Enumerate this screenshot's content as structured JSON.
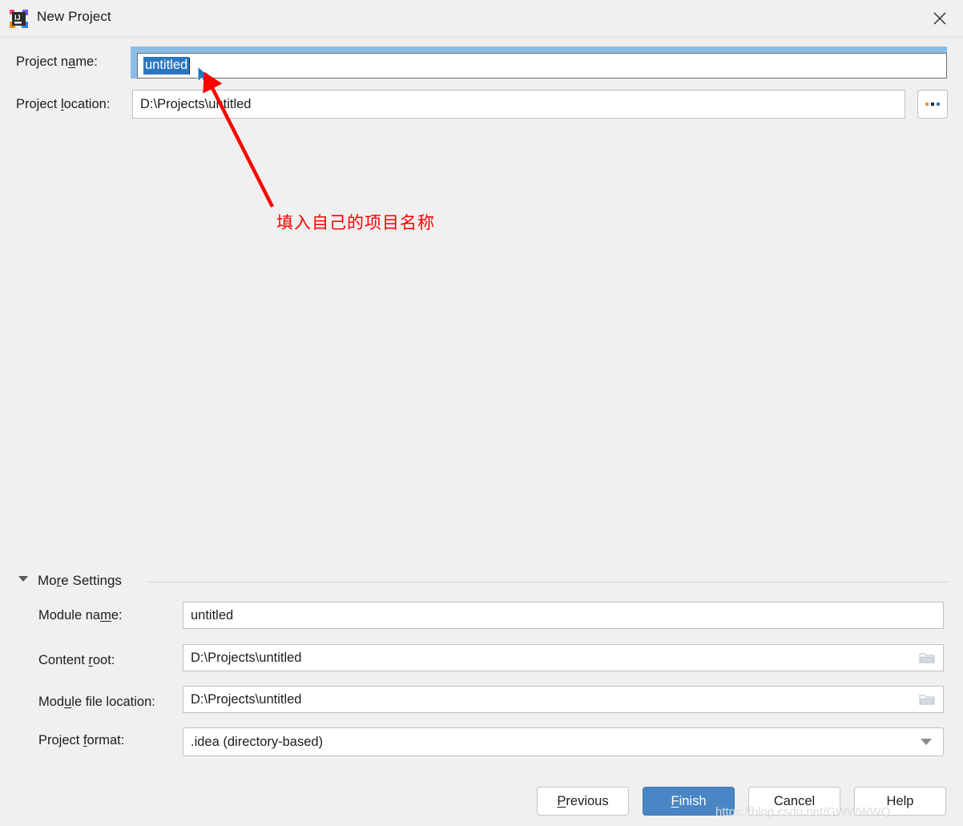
{
  "window": {
    "title": "New Project",
    "app_icon": "intellij-idea-icon",
    "close_icon": "close-icon"
  },
  "form": {
    "project_name": {
      "label_pre": "Project n",
      "label_mnemonic": "a",
      "label_post": "me:",
      "value": "untitled",
      "selected": true
    },
    "project_location": {
      "label_pre": "Project ",
      "label_mnemonic": "l",
      "label_post": "ocation:",
      "value": "D:\\Projects\\untitled"
    },
    "browse_button": {
      "icon": "ellipsis-icon",
      "label": "..."
    }
  },
  "more_settings": {
    "label_pre": "Mo",
    "label_mnemonic": "r",
    "label_post": "e Settings",
    "expanded": true,
    "collapse_icon": "triangle-down-icon",
    "fields": [
      {
        "name": "module-name",
        "label_pre": "Module na",
        "label_mnemonic": "m",
        "label_post": "e:",
        "value": "untitled",
        "trailing_icon": null
      },
      {
        "name": "content-root",
        "label_pre": "Content ",
        "label_mnemonic": "r",
        "label_post": "oot:",
        "value": "D:\\Projects\\untitled",
        "trailing_icon": "folder-icon"
      },
      {
        "name": "module-file-location",
        "label_pre": "Mod",
        "label_mnemonic": "u",
        "label_post": "le file location:",
        "value": "D:\\Projects\\untitled",
        "trailing_icon": "folder-icon"
      },
      {
        "name": "project-format",
        "label_pre": "Project ",
        "label_mnemonic": "f",
        "label_post": "ormat:",
        "value": ".idea (directory-based)",
        "trailing_icon": "chevron-down-icon"
      }
    ]
  },
  "buttons": {
    "previous": {
      "pre": "",
      "mnemonic": "P",
      "post": "revious"
    },
    "finish": {
      "pre": "",
      "mnemonic": "F",
      "post": "inish",
      "primary": true
    },
    "cancel": {
      "pre": "Cancel",
      "mnemonic": "",
      "post": ""
    },
    "help": {
      "pre": "Help",
      "mnemonic": "",
      "post": ""
    }
  },
  "annotation": {
    "text": "填入自己的项目名称",
    "color": "#ff0000",
    "arrow": "red-arrow-pointing-to-project-name"
  },
  "watermark": {
    "text": "https://blog.csdn.net/GWWWWQ"
  },
  "colors": {
    "background": "#f0f0f0",
    "accent_blue": "#4a86c5",
    "selection_blue": "#2d76bf",
    "focus_ring": "#8cbce8",
    "annotation_red": "#ff0000"
  }
}
